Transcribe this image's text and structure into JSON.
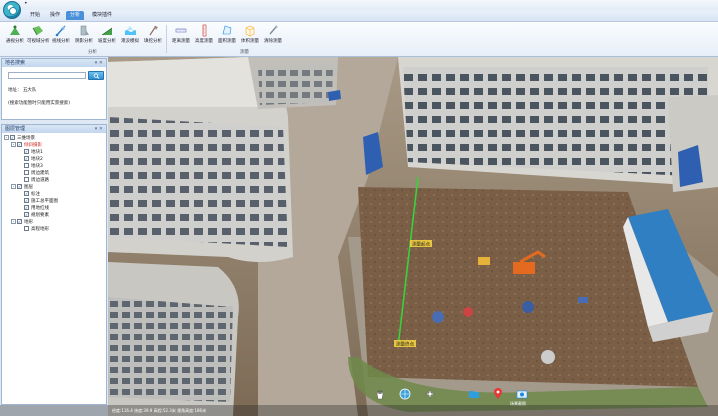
{
  "menu": {
    "tabs": [
      "开始",
      "操作",
      "分析",
      "模块插件"
    ],
    "active_index": 2
  },
  "ribbon": {
    "buttons": [
      {
        "label": "通视分析",
        "icon": "visibility-analysis-icon"
      },
      {
        "label": "可视域分析",
        "icon": "viewshed-icon"
      },
      {
        "label": "视线分析",
        "icon": "sightline-icon"
      },
      {
        "label": "阴影分析",
        "icon": "shadow-analysis-icon"
      },
      {
        "label": "坡度分析",
        "icon": "slope-analysis-icon"
      },
      {
        "label": "淹没模拟",
        "icon": "flood-simulation-icon"
      },
      {
        "label": "填挖分析",
        "icon": "cut-fill-icon"
      },
      {
        "label": "距离测量",
        "icon": "distance-measure-icon"
      },
      {
        "label": "高度测量",
        "icon": "height-measure-icon"
      },
      {
        "label": "面积测量",
        "icon": "area-measure-icon"
      },
      {
        "label": "体积测量",
        "icon": "volume-measure-icon"
      },
      {
        "label": "清除测量",
        "icon": "clear-measure-icon"
      }
    ],
    "groups": [
      "分析",
      "测量"
    ]
  },
  "location_panel": {
    "title": "地名搜索",
    "search_placeholder": "",
    "result_label": "地址：",
    "result_value": "五大队",
    "hint": "(搜索功能暂时只能用实景搜索)"
  },
  "layer_panel": {
    "title": "图层管理",
    "tree": [
      {
        "label": "三维场景",
        "level": 0,
        "expand": "-",
        "checked": true,
        "red": false
      },
      {
        "label": "倾斜摄影",
        "level": 1,
        "expand": "-",
        "checked": true,
        "red": true
      },
      {
        "label": "地块1",
        "level": 2,
        "expand": "",
        "checked": true,
        "red": false
      },
      {
        "label": "地块2",
        "level": 2,
        "expand": "",
        "checked": true,
        "red": false
      },
      {
        "label": "地块3",
        "level": 2,
        "expand": "",
        "checked": false,
        "red": false
      },
      {
        "label": "周边建筑",
        "level": 2,
        "expand": "",
        "checked": false,
        "red": false
      },
      {
        "label": "周边道路",
        "level": 2,
        "expand": "",
        "checked": false,
        "red": false
      },
      {
        "label": "图层",
        "level": 1,
        "expand": "-",
        "checked": true,
        "red": false
      },
      {
        "label": "标注",
        "level": 2,
        "expand": "",
        "checked": true,
        "red": false
      },
      {
        "label": "施工总平面图",
        "level": 2,
        "expand": "",
        "checked": true,
        "red": false
      },
      {
        "label": "用地红线",
        "level": 2,
        "expand": "",
        "checked": true,
        "red": false
      },
      {
        "label": "规划要素",
        "level": 2,
        "expand": "",
        "checked": true,
        "red": false
      },
      {
        "label": "地形",
        "level": 1,
        "expand": "-",
        "checked": true,
        "red": false
      },
      {
        "label": "高程地形",
        "level": 2,
        "expand": "",
        "checked": false,
        "red": false
      }
    ]
  },
  "scene": {
    "labels": [
      {
        "text": "测量起点"
      },
      {
        "text": "测量终点"
      }
    ],
    "toolbar_icons": [
      "pan-hand-icon",
      "globe-reset-icon",
      "navigate-icon",
      "folder-icon",
      "location-pin-icon",
      "screenshot-icon"
    ],
    "toolbar_label": "场景截图"
  },
  "statusbar": {
    "text": "经度:116.4 纬度:39.9 高程:52.3米 视角高度:186米"
  }
}
